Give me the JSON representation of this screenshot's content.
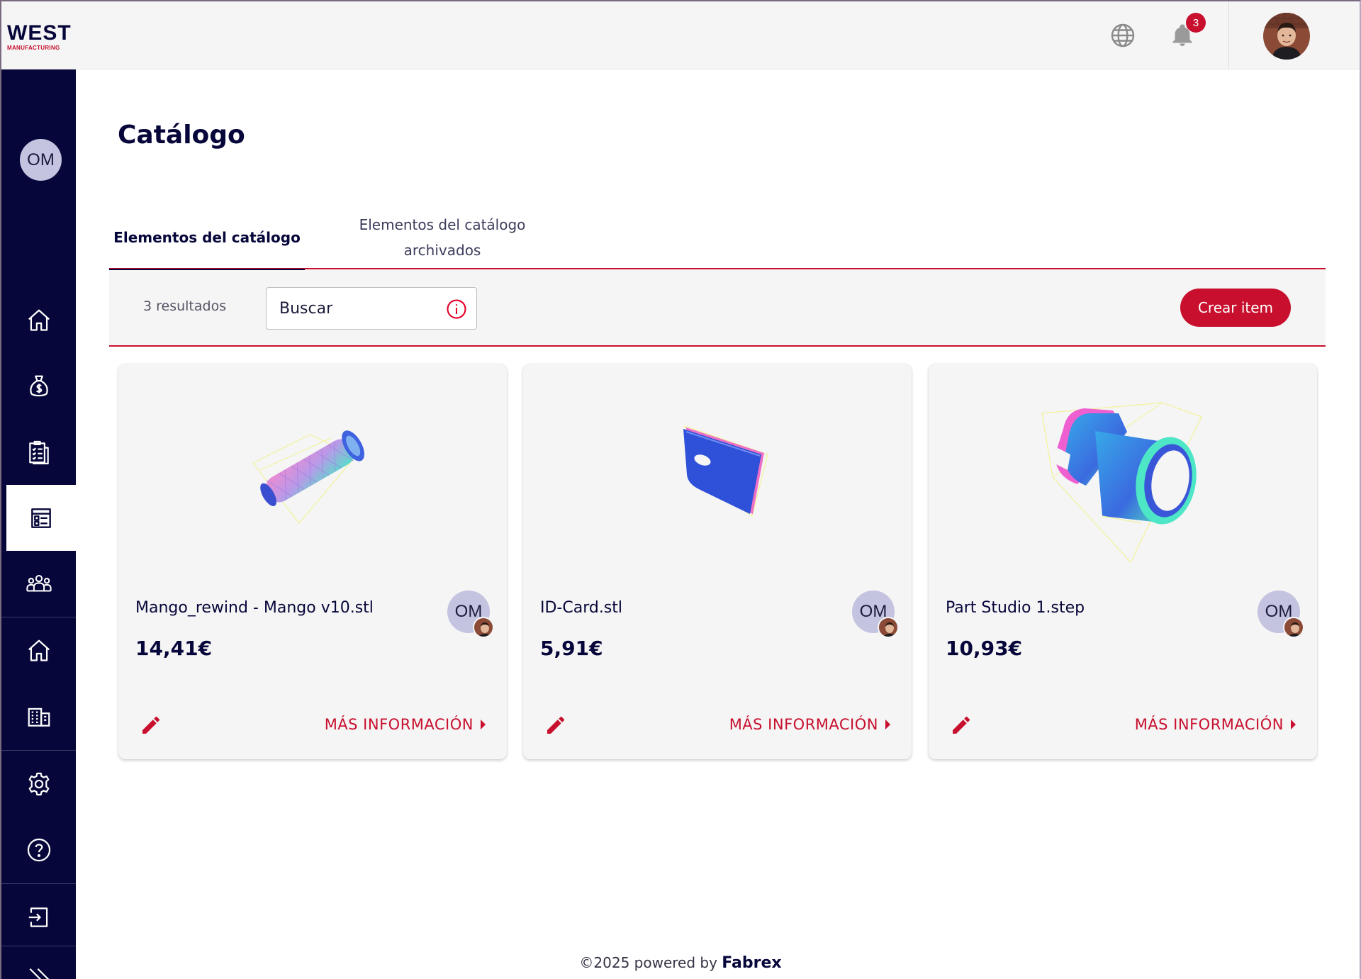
{
  "header": {
    "logo_main": "WEST",
    "logo_sub": "MANUFACTURING",
    "notification_count": "3"
  },
  "sidebar": {
    "avatar_initials": "OM",
    "items": [
      {
        "icon": "home-icon"
      },
      {
        "icon": "money-bag-icon"
      },
      {
        "icon": "clipboard-checklist-icon"
      },
      {
        "icon": "catalog-icon",
        "active": true
      },
      {
        "icon": "users-icon"
      },
      {
        "icon": "home-icon"
      },
      {
        "icon": "building-icon"
      },
      {
        "icon": "gear-icon"
      },
      {
        "icon": "help-icon"
      },
      {
        "icon": "logout-icon"
      },
      {
        "icon": "double-chevron-right-icon"
      }
    ]
  },
  "page": {
    "title": "Catálogo"
  },
  "tabs": [
    {
      "label": "Elementos del catálogo",
      "active": true
    },
    {
      "label": "Elementos del catálogo archivados",
      "active": false
    }
  ],
  "toolbar": {
    "results": "3 resultados",
    "search_placeholder": "Buscar",
    "create_label": "Crear item"
  },
  "cards": [
    {
      "name": "Mango_rewind - Mango v10.stl",
      "price": "14,41€",
      "owner": "OM",
      "more": "MÁS INFORMACIÓN"
    },
    {
      "name": "ID-Card.stl",
      "price": "5,91€",
      "owner": "OM",
      "more": "MÁS INFORMACIÓN"
    },
    {
      "name": "Part Studio 1.step",
      "price": "10,93€",
      "owner": "OM",
      "more": "MÁS INFORMACIÓN"
    }
  ],
  "footer": {
    "text": "©2025 powered by",
    "brand": "Fabrex"
  },
  "colors": {
    "navy": "#06063a",
    "accent": "#c8102e",
    "panel": "#f5f5f5"
  }
}
